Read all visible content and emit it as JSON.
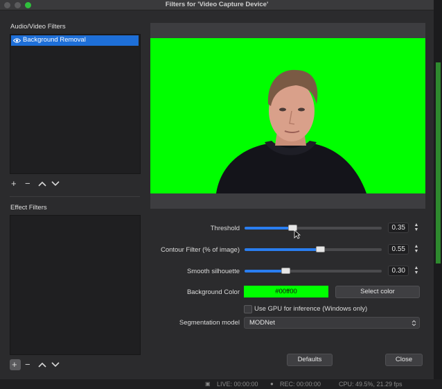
{
  "window": {
    "title": "Filters for 'Video Capture Device'"
  },
  "audio_video_filters": {
    "label": "Audio/Video Filters",
    "items": [
      {
        "label": "Background Removal",
        "icon": "eye-icon"
      }
    ]
  },
  "effect_filters": {
    "label": "Effect Filters",
    "items": []
  },
  "list_controls": {
    "add": "+",
    "remove": "−",
    "up": "▲",
    "down": "▼"
  },
  "properties": {
    "threshold": {
      "label": "Threshold",
      "value": "0.35",
      "fraction": 0.35
    },
    "contour": {
      "label": "Contour Filter (% of image)",
      "value": "0.55",
      "fraction": 0.55
    },
    "smooth": {
      "label": "Smooth silhouette",
      "value": "0.30",
      "fraction": 0.3
    },
    "background_color": {
      "label": "Background Color",
      "value": "#00ff00",
      "color": "#00ff00",
      "select_label": "Select color"
    },
    "use_gpu": {
      "label": "Use GPU for inference (Windows only)",
      "checked": false
    },
    "segmentation": {
      "label": "Segmentation model",
      "value": "MODNet"
    }
  },
  "buttons": {
    "defaults": "Defaults",
    "close": "Close"
  },
  "status": {
    "live": "LIVE: 00:00:00",
    "rec": "REC: 00:00:00",
    "cpu": "CPU: 49.5%, 21.29 fps"
  },
  "colors": {
    "accent": "#1e6fd8",
    "slider_fill": "#2a7ef0",
    "chroma": "#00ff00"
  }
}
